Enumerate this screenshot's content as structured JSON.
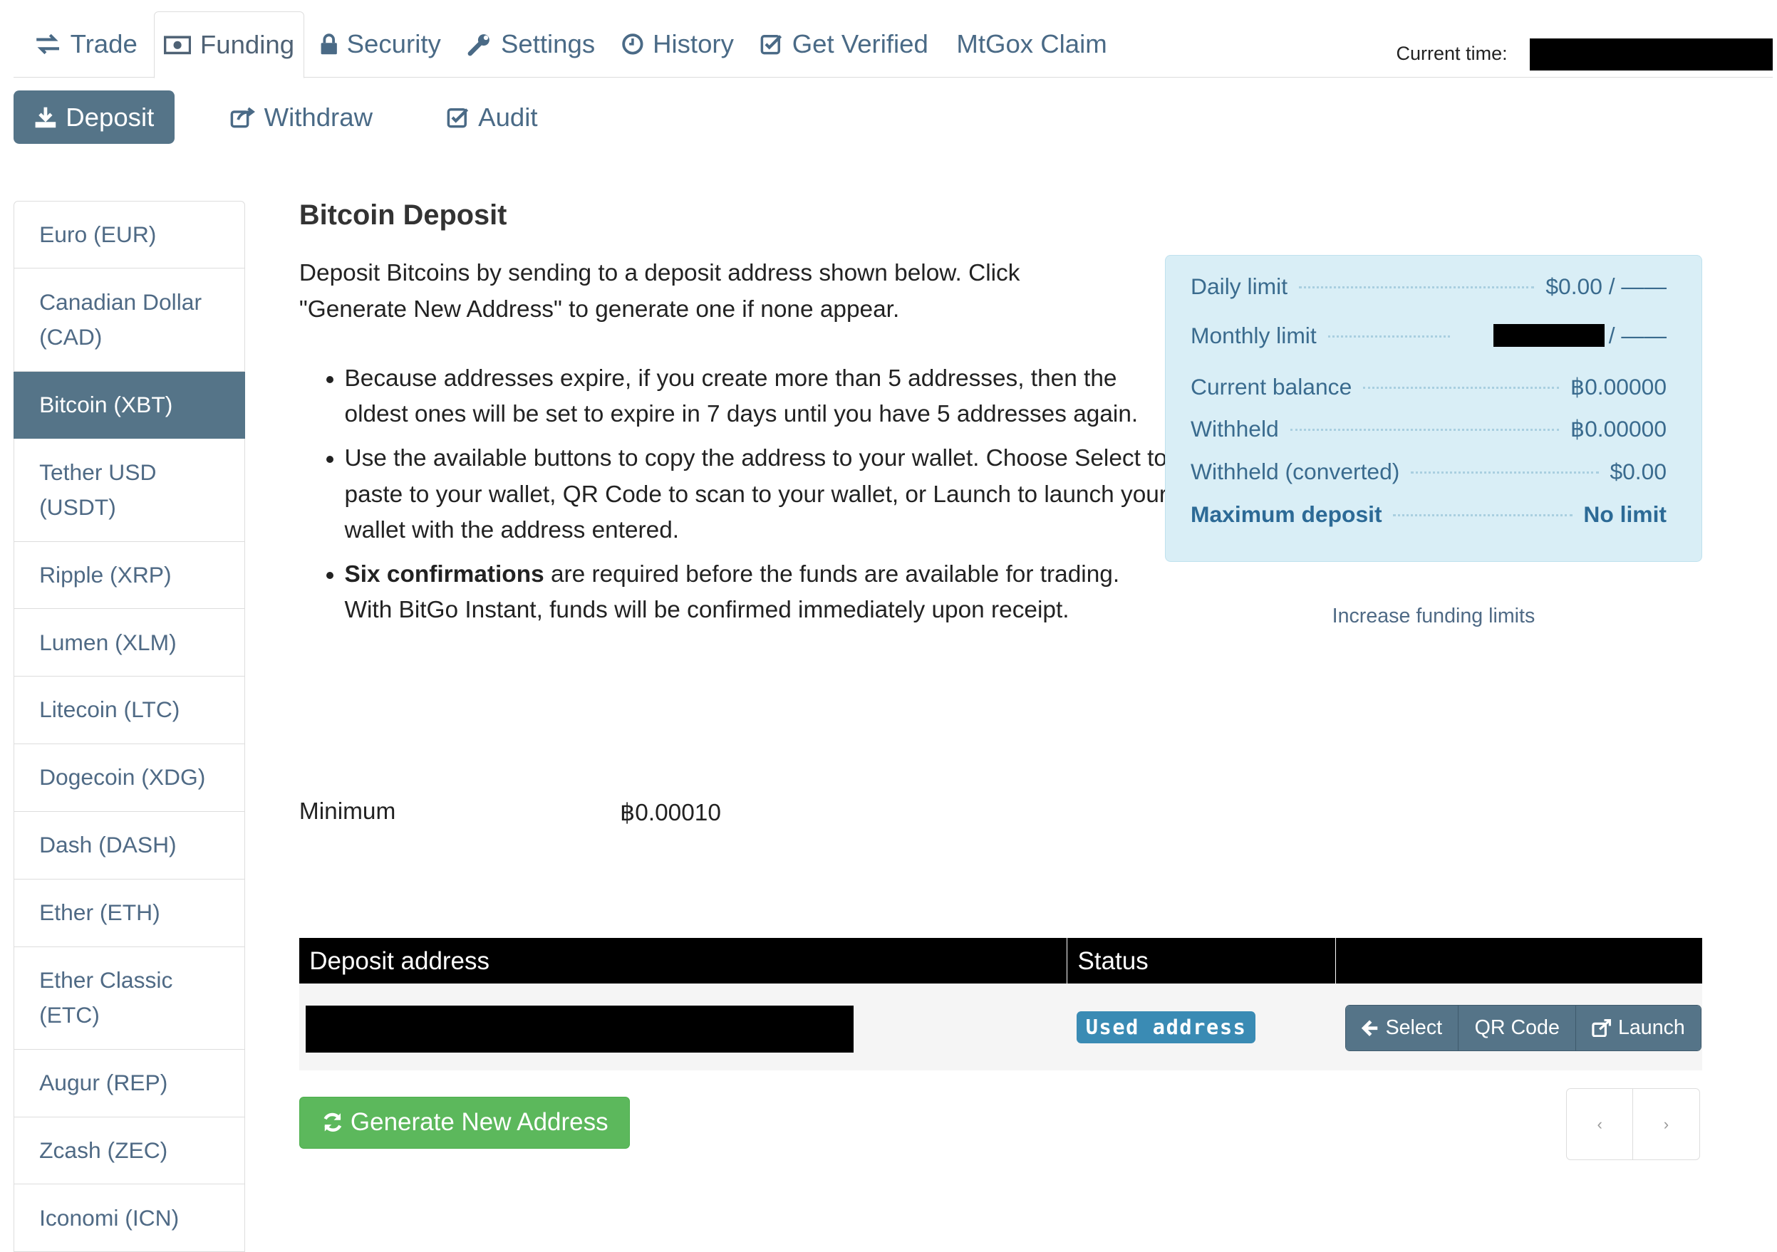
{
  "top_tabs": [
    {
      "label": "Trade",
      "icon": "exchange-icon"
    },
    {
      "label": "Funding",
      "icon": "money-icon"
    },
    {
      "label": "Security",
      "icon": "lock-icon"
    },
    {
      "label": "Settings",
      "icon": "wrench-icon"
    },
    {
      "label": "History",
      "icon": "clock-icon"
    },
    {
      "label": "Get Verified",
      "icon": "check-square-icon"
    },
    {
      "label": "MtGox Claim",
      "icon": ""
    }
  ],
  "active_tab": "Funding",
  "current_time_label": "Current time:",
  "subnav": {
    "deposit": "Deposit",
    "withdraw": "Withdraw",
    "audit": "Audit",
    "active": "Deposit"
  },
  "sidebar": {
    "items": [
      "Euro (EUR)",
      "Canadian Dollar (CAD)",
      "Bitcoin (XBT)",
      "Tether USD (USDT)",
      "Ripple (XRP)",
      "Lumen (XLM)",
      "Litecoin (LTC)",
      "Dogecoin (XDG)",
      "Dash (DASH)",
      "Ether (ETH)",
      "Ether Classic (ETC)",
      "Augur (REP)",
      "Zcash (ZEC)",
      "Iconomi (ICN)"
    ],
    "active": "Bitcoin (XBT)"
  },
  "main": {
    "title": "Bitcoin Deposit",
    "intro": "Deposit Bitcoins by sending to a deposit address shown below. Click \"Generate New Address\" to generate one if none appear.",
    "bullet1": "Because addresses expire, if you create more than 5 addresses, then the oldest ones will be set to expire in 7 days until you have 5 addresses again.",
    "bullet2": "Use the available buttons to copy the address to your wallet. Choose Select to paste to your wallet, QR Code to scan to your wallet, or Launch to launch your wallet with the address entered.",
    "bullet3_strong": "Six confirmations",
    "bullet3_rest": " are required before the funds are available for trading. With BitGo Instant, funds will be confirmed immediately upon receipt.",
    "minimum_label": "Minimum",
    "minimum_value": "฿0.00010"
  },
  "limits": {
    "daily_label": "Daily limit",
    "daily_value": "$0.00 / ——",
    "monthly_label": "Monthly limit",
    "monthly_value": "/ ——",
    "balance_label": "Current balance",
    "balance_value": "฿0.00000",
    "withheld_label": "Withheld",
    "withheld_value": "฿0.00000",
    "withheld_conv_label": "Withheld (converted)",
    "withheld_conv_value": "$0.00",
    "max_label": "Maximum deposit",
    "max_value": "No limit",
    "increase_link": "Increase funding limits"
  },
  "table": {
    "col_address": "Deposit address",
    "col_status": "Status",
    "status_badge": "Used address",
    "btn_select": "Select",
    "btn_qr": "QR Code",
    "btn_launch": "Launch"
  },
  "generate_button": "Generate New Address",
  "pager": {
    "prev": "‹",
    "next": "›"
  },
  "colors": {
    "primary": "#557488",
    "link": "#4a6a86",
    "info_bg": "#d9eef6",
    "success": "#5cb85c",
    "badge": "#3a8bb4"
  }
}
